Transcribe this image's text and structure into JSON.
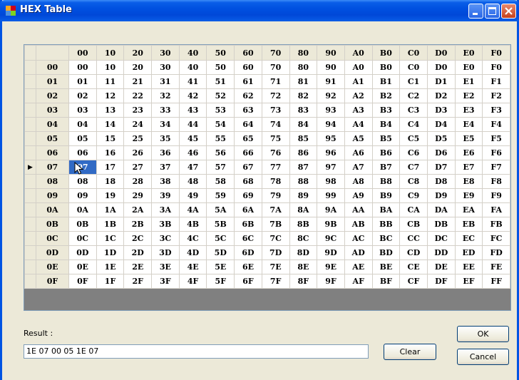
{
  "window": {
    "title": "HEX Table"
  },
  "table": {
    "columns": [
      "00",
      "10",
      "20",
      "30",
      "40",
      "50",
      "60",
      "70",
      "80",
      "90",
      "A0",
      "B0",
      "C0",
      "D0",
      "E0",
      "F0"
    ],
    "rows": [
      {
        "label": "00",
        "cells": [
          "00",
          "10",
          "20",
          "30",
          "40",
          "50",
          "60",
          "70",
          "80",
          "90",
          "A0",
          "B0",
          "C0",
          "D0",
          "E0",
          "F0"
        ]
      },
      {
        "label": "01",
        "cells": [
          "01",
          "11",
          "21",
          "31",
          "41",
          "51",
          "61",
          "71",
          "81",
          "91",
          "A1",
          "B1",
          "C1",
          "D1",
          "E1",
          "F1"
        ]
      },
      {
        "label": "02",
        "cells": [
          "02",
          "12",
          "22",
          "32",
          "42",
          "52",
          "62",
          "72",
          "82",
          "92",
          "A2",
          "B2",
          "C2",
          "D2",
          "E2",
          "F2"
        ]
      },
      {
        "label": "03",
        "cells": [
          "03",
          "13",
          "23",
          "33",
          "43",
          "53",
          "63",
          "73",
          "83",
          "93",
          "A3",
          "B3",
          "C3",
          "D3",
          "E3",
          "F3"
        ]
      },
      {
        "label": "04",
        "cells": [
          "04",
          "14",
          "24",
          "34",
          "44",
          "54",
          "64",
          "74",
          "84",
          "94",
          "A4",
          "B4",
          "C4",
          "D4",
          "E4",
          "F4"
        ]
      },
      {
        "label": "05",
        "cells": [
          "05",
          "15",
          "25",
          "35",
          "45",
          "55",
          "65",
          "75",
          "85",
          "95",
          "A5",
          "B5",
          "C5",
          "D5",
          "E5",
          "F5"
        ]
      },
      {
        "label": "06",
        "cells": [
          "06",
          "16",
          "26",
          "36",
          "46",
          "56",
          "66",
          "76",
          "86",
          "96",
          "A6",
          "B6",
          "C6",
          "D6",
          "E6",
          "F6"
        ]
      },
      {
        "label": "07",
        "cells": [
          "07",
          "17",
          "27",
          "37",
          "47",
          "57",
          "67",
          "77",
          "87",
          "97",
          "A7",
          "B7",
          "C7",
          "D7",
          "E7",
          "F7"
        ]
      },
      {
        "label": "08",
        "cells": [
          "08",
          "18",
          "28",
          "38",
          "48",
          "58",
          "68",
          "78",
          "88",
          "98",
          "A8",
          "B8",
          "C8",
          "D8",
          "E8",
          "F8"
        ]
      },
      {
        "label": "09",
        "cells": [
          "09",
          "19",
          "29",
          "39",
          "49",
          "59",
          "69",
          "79",
          "89",
          "99",
          "A9",
          "B9",
          "C9",
          "D9",
          "E9",
          "F9"
        ]
      },
      {
        "label": "0A",
        "cells": [
          "0A",
          "1A",
          "2A",
          "3A",
          "4A",
          "5A",
          "6A",
          "7A",
          "8A",
          "9A",
          "AA",
          "BA",
          "CA",
          "DA",
          "EA",
          "FA"
        ]
      },
      {
        "label": "0B",
        "cells": [
          "0B",
          "1B",
          "2B",
          "3B",
          "4B",
          "5B",
          "6B",
          "7B",
          "8B",
          "9B",
          "AB",
          "BB",
          "CB",
          "DB",
          "EB",
          "FB"
        ]
      },
      {
        "label": "0C",
        "cells": [
          "0C",
          "1C",
          "2C",
          "3C",
          "4C",
          "5C",
          "6C",
          "7C",
          "8C",
          "9C",
          "AC",
          "BC",
          "CC",
          "DC",
          "EC",
          "FC"
        ]
      },
      {
        "label": "0D",
        "cells": [
          "0D",
          "1D",
          "2D",
          "3D",
          "4D",
          "5D",
          "6D",
          "7D",
          "8D",
          "9D",
          "AD",
          "BD",
          "CD",
          "DD",
          "ED",
          "FD"
        ]
      },
      {
        "label": "0E",
        "cells": [
          "0E",
          "1E",
          "2E",
          "3E",
          "4E",
          "5E",
          "6E",
          "7E",
          "8E",
          "9E",
          "AE",
          "BE",
          "CE",
          "DE",
          "EE",
          "FE"
        ]
      },
      {
        "label": "0F",
        "cells": [
          "0F",
          "1F",
          "2F",
          "3F",
          "4F",
          "5F",
          "6F",
          "7F",
          "8F",
          "9F",
          "AF",
          "BF",
          "CF",
          "DF",
          "EF",
          "FF"
        ]
      }
    ],
    "current_row": 7,
    "selected_cell": {
      "row": 7,
      "col": 0
    },
    "current_row_marker": "▶"
  },
  "result": {
    "label": "Result :",
    "value": "1E 07 00 05 1E 07"
  },
  "buttons": {
    "clear": "Clear",
    "ok": "OK",
    "cancel": "Cancel"
  },
  "colors": {
    "selection": "#316ac5",
    "titlebar": "#0054e3"
  }
}
